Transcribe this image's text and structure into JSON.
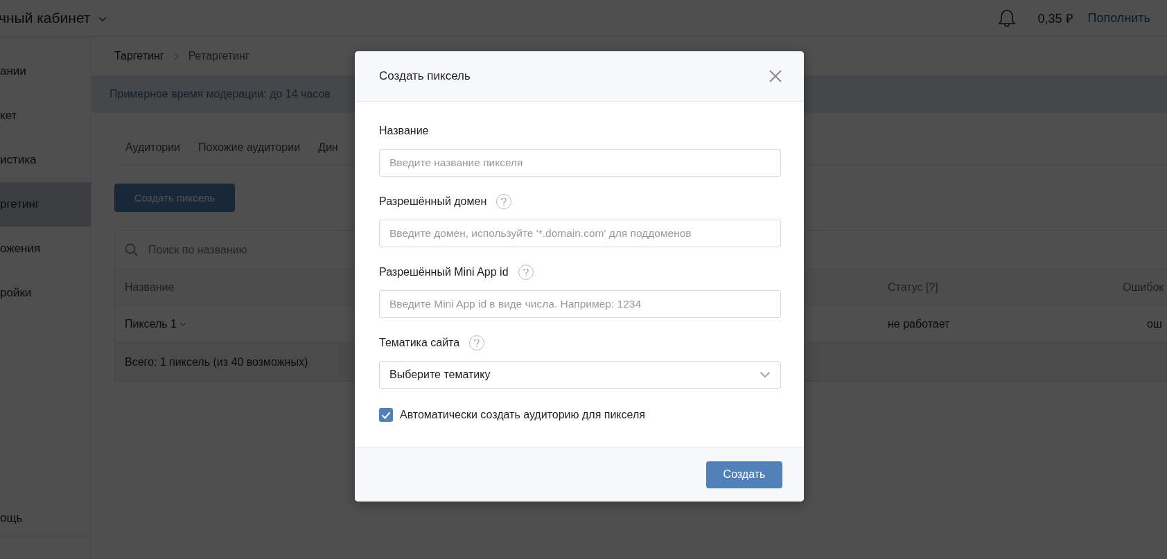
{
  "top_bar": {
    "title": "чный кабинет",
    "balance": "0,35 ₽",
    "top_up": "Пополнить"
  },
  "sidebar": {
    "items": [
      {
        "label": "ании",
        "selected": false
      },
      {
        "label": "кет",
        "selected": false
      },
      {
        "label": "истика",
        "selected": false
      },
      {
        "label": "ргетинг",
        "selected": true
      },
      {
        "label": "ожения",
        "selected": false
      },
      {
        "label": "ройки",
        "selected": false
      }
    ],
    "bottom_item": "ощь"
  },
  "breadcrumbs": [
    {
      "label": "Таргетинг"
    },
    {
      "label": "Ретаргетинг"
    }
  ],
  "banner": "Примерное время модерации: до 14 часов",
  "tabs": [
    {
      "label": "Аудитории",
      "selected": false
    },
    {
      "label": "Похожие аудитории",
      "selected": false
    },
    {
      "label": "Дин",
      "selected": false
    }
  ],
  "create_button": "Создать пиксель",
  "table": {
    "search_placeholder": "Поиск по названию",
    "columns": [
      "Название",
      "Статус [?]",
      "Ошибок"
    ],
    "rows": [
      [
        "Пиксель 1",
        "не работает",
        "ош"
      ]
    ],
    "footer": "Всего: 1 пиксель (из 40 возможных)"
  },
  "modal": {
    "title": "Создать пиксель",
    "fields": [
      {
        "kind": "input",
        "label": "Название",
        "help": false,
        "placeholder": "Введите название пикселя"
      },
      {
        "kind": "input",
        "label": "Разрешённый домен",
        "help": true,
        "placeholder": "Введите домен, используйте '*.domain.com' для поддоменов"
      },
      {
        "kind": "input",
        "label": "Разрешённый Mini App id",
        "help": true,
        "placeholder": "Введите Mini App id в виде числа. Например: 1234"
      },
      {
        "kind": "select",
        "label": "Тематика сайта",
        "help": true,
        "value": "Выберите тематику"
      }
    ],
    "checkbox": {
      "label": "Автоматически создать аудиторию для пикселя",
      "checked": true
    },
    "submit": "Создать"
  }
}
